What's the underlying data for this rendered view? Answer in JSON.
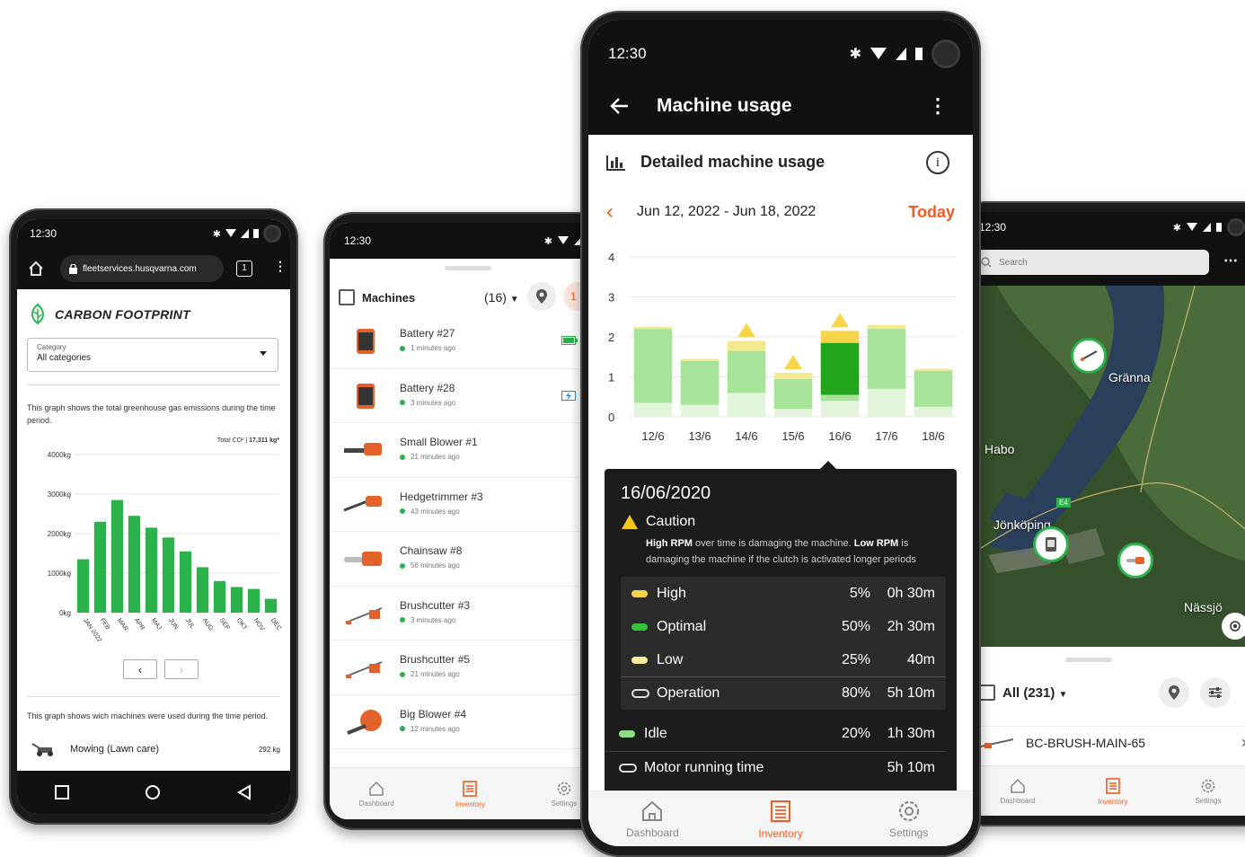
{
  "phone1": {
    "status": {
      "time": "12:30"
    },
    "browser": {
      "url": "fleetservices.husqvarna.com",
      "tab_count": "1"
    },
    "title": "CARBON FOOTPRINT",
    "category": {
      "label": "Category",
      "value": "All categories"
    },
    "description": "This graph shows the total greenhouse gas emissions during the time period.",
    "total": {
      "label": "Total CO²",
      "value": "17,311 kg*"
    },
    "second_description": "This graph shows wich machines were used during the time period.",
    "machine_row": {
      "name": "Mowing (Lawn care)",
      "value": "292 kg"
    }
  },
  "phone2": {
    "status": {
      "time": "12:30"
    },
    "header": {
      "title": "Machines",
      "count": "(16)",
      "extra": "1"
    },
    "machines": [
      {
        "name": "Battery #27",
        "time": "1 minutes ago",
        "icon": "battery-icon"
      },
      {
        "name": "Battery #28",
        "time": "3 minutes ago",
        "icon": "battery-icon"
      },
      {
        "name": "Small Blower #1",
        "time": "21 minutes ago",
        "icon": "blower-icon"
      },
      {
        "name": "Hedgetrimmer #3",
        "time": "43 minutes ago",
        "icon": "hedgetrimmer-icon"
      },
      {
        "name": "Chainsaw #8",
        "time": "56 minutes ago",
        "icon": "chainsaw-icon"
      },
      {
        "name": "Brushcutter #3",
        "time": "3 minutes ago",
        "icon": "brushcutter-icon"
      },
      {
        "name": "Brushcutter #5",
        "time": "21 minutes ago",
        "icon": "brushcutter-icon"
      },
      {
        "name": "Big Blower #4",
        "time": "12 minutes ago",
        "icon": "backpack-blower-icon"
      }
    ],
    "nav": {
      "dashboard": "Dashboard",
      "inventory": "Inventory",
      "settings": "Settings"
    }
  },
  "phone3": {
    "status": {
      "time": "12:30"
    },
    "appbar": {
      "title": "Machine usage"
    },
    "section_title": "Detailed machine usage",
    "date_range": "Jun 12, 2022 - Jun 18, 2022",
    "today_label": "Today",
    "tooltip": {
      "date": "16/06/2020",
      "caution_title": "Caution",
      "desc_part1": "High RPM",
      "desc_part2": " over time is damaging the machine. ",
      "desc_part3": "Low RPM",
      "desc_part4": " is damaging the machine if the clutch is activated longer periods",
      "rows": [
        {
          "label": "High",
          "pct": "5%",
          "dur": "0h 30m",
          "color": "#f7d44a"
        },
        {
          "label": "Optimal",
          "pct": "50%",
          "dur": "2h 30m",
          "color": "#35c13c"
        },
        {
          "label": "Low",
          "pct": "25%",
          "dur": "40m",
          "color": "#f9ec9a"
        },
        {
          "label": "Operation",
          "pct": "80%",
          "dur": "5h 10m"
        },
        {
          "label": "Idle",
          "pct": "20%",
          "dur": "1h 30m",
          "color": "#8fe083"
        },
        {
          "label": "Motor running time",
          "pct": "",
          "dur": "5h 10m"
        }
      ]
    },
    "nav": {
      "dashboard": "Dashboard",
      "inventory": "Inventory",
      "settings": "Settings"
    }
  },
  "phone4": {
    "status": {
      "time": "12:30"
    },
    "search": {
      "placeholder": "Search"
    },
    "map_labels": {
      "granna": "Gränna",
      "habo": "Habo",
      "jonkoping": "Jönköping",
      "nassjo": "Nässjö",
      "road": "E4"
    },
    "filter": {
      "label": "All (231)"
    },
    "first_item": "BC-BRUSH-MAIN-65",
    "nav": {
      "dashboard": "Dashboard",
      "inventory": "Inventory",
      "settings": "Settings"
    }
  },
  "colors": {
    "brand_orange": "#f35a20",
    "green": "#2ab24b",
    "dark": "#111111"
  },
  "chart_data": [
    {
      "type": "bar",
      "categories": [
        "JAN 2022",
        "FEB",
        "MAR",
        "APR",
        "MAJ",
        "JUN",
        "JUL",
        "AUG",
        "SEP",
        "OKT",
        "NOV",
        "DEC"
      ],
      "values": [
        1350,
        2300,
        2850,
        2450,
        2150,
        1900,
        1550,
        1150,
        800,
        650,
        600,
        350
      ],
      "yticks": [
        "4000kg",
        "3000kg",
        "2000kg",
        "1000kg",
        "0kg"
      ],
      "ylim": [
        0,
        4000
      ],
      "ylabel": "",
      "xlabel": "",
      "title": "",
      "color": "#2ab24b"
    },
    {
      "type": "bar",
      "stacked": true,
      "categories": [
        "12/6",
        "13/6",
        "14/6",
        "15/6",
        "16/6",
        "17/6",
        "18/6"
      ],
      "yticks": [
        "4",
        "3",
        "2",
        "1",
        "0"
      ],
      "ylim": [
        0,
        4
      ],
      "series": [
        {
          "values": [
            0.35,
            0.3,
            0.6,
            0.2,
            0.4,
            0.7,
            0.25
          ],
          "color": "#e3f5da"
        },
        {
          "values": [
            1.85,
            1.1,
            1.05,
            0.75,
            1.35,
            1.5,
            0.9
          ],
          "color": "#a8e39a"
        },
        {
          "values": [
            0.05,
            0.05,
            0.25,
            0.15,
            0.2,
            0.1,
            0.05
          ],
          "color": "#f4e88e"
        },
        {
          "values": [
            0,
            0,
            0,
            0,
            0.0,
            0,
            0
          ],
          "color": "#35c13c"
        }
      ],
      "selected_index": 4,
      "selected_series": [
        {
          "value": 0.15,
          "color": "#a8e39a"
        },
        {
          "value": 1.3,
          "color": "#22a51a"
        },
        {
          "value": 0.3,
          "color": "#f7d44a"
        }
      ],
      "warnings": [
        "14/6",
        "15/6",
        "16/6"
      ]
    }
  ]
}
